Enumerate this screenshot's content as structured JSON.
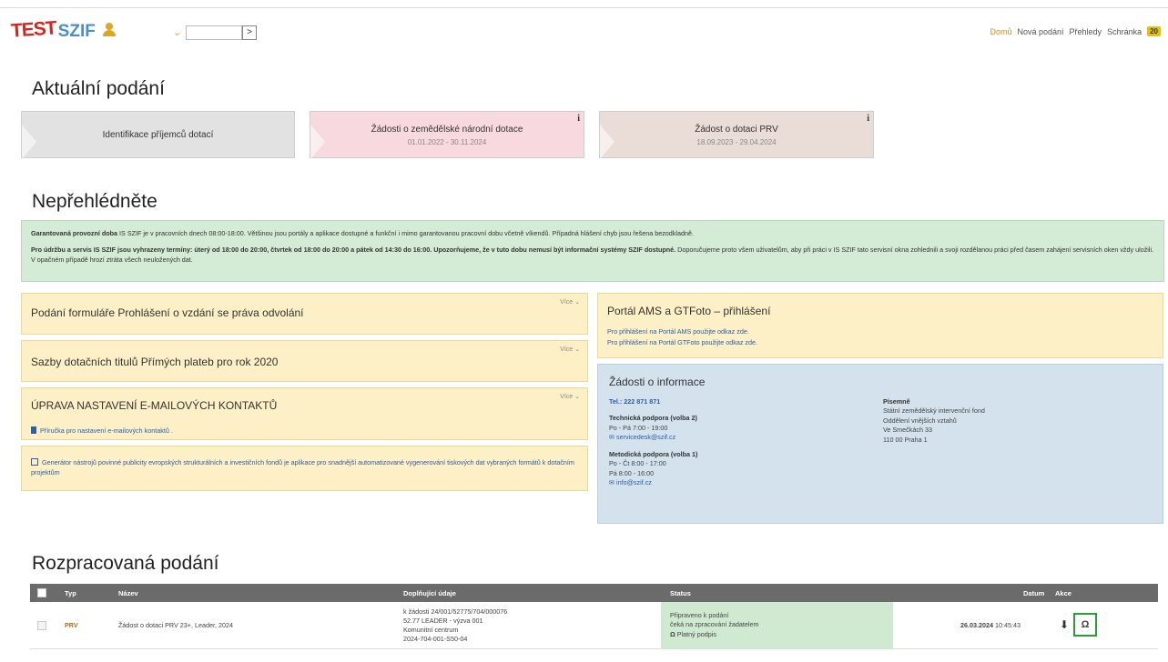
{
  "header": {
    "logo_test": "TEST",
    "logo_szif": "SZIF",
    "go_symbol": ">",
    "nav": [
      "Domů",
      "Nová podání",
      "Přehledy",
      "Schránka"
    ],
    "inbox_count": "20"
  },
  "current": {
    "title": "Aktuální podání",
    "tiles": [
      {
        "title": "Identifikace příjemců dotací",
        "dates": ""
      },
      {
        "title": "Žádosti o zemědělské národní dotace",
        "dates": "01.01.2022 - 30.11.2024",
        "info": "i"
      },
      {
        "title": "Žádost o dotaci PRV",
        "dates": "18.09.2023 - 29.04.2024",
        "info": "i"
      }
    ]
  },
  "notice": {
    "title": "Nepřehlédněte",
    "p1_bold": "Garantovaná provozní doba",
    "p1_rest": " IS SZIF je v pracovních dnech 08:00-18:00. Většinou jsou portály a aplikace dostupné a funkční i mimo garantovanou pracovní dobu včetně víkendů. Případná hlášení chyb jsou řešena bezodkladně.",
    "p2_bold": "Pro údržbu a servis IS SZIF jsou vyhrazeny termíny: úterý od 18:00 do 20:00, čtvrtek od 18:00 do 20:00 a pátek od 14:30 do 16:00. Upozorňujeme, že v tuto dobu nemusí být informační systémy SZIF dostupné.",
    "p2_rest": " Doporučujeme proto všem uživatelům, aby při práci v IS SZIF tato servisní okna zohlednili a svoji rozdělanou práci před časem zahájení servisních oken vždy uložili. V opačném případě hrozí ztráta všech neuložených dat."
  },
  "cards": {
    "more": "Více",
    "card1": "Podání formuláře Prohlášení o vzdání se práva odvolání",
    "card2": "Sazby dotačních titulů Přímých plateb pro rok 2020",
    "card3": "ÚPRAVA NASTAVENÍ E-MAILOVÝCH KONTAKTŮ",
    "card3_link": "Příručka pro nastavení e-mailových kontaktů .",
    "card4": "Generátor nástrojů povinné publicity evropských strukturálních a investičních fondů je aplikace pro snadnější automatizované vygenerování tiskových dat vybraných formátů k dotačním projektům",
    "portal_title": "Portál AMS a GTFoto – přihlášení",
    "portal_l1": "Pro přihlášení na Portál AMS použijte odkaz zde.",
    "portal_l2": "Pro přihlášení na Portál GTFoto použijte odkaz zde."
  },
  "info": {
    "title": "Žádosti o informace",
    "tel": "Tel.: 222 871 871",
    "tech_label": "Technická podpora (volba 2)",
    "tech_hours": "Po - Pá 7:00 - 19:00",
    "tech_mail": "servicedesk@szif.cz",
    "met_label": "Metodická podpora (volba 1)",
    "met_h1": "Po - Čt 8:00 - 17:00",
    "met_h2": "Pá 8:00 - 16:00",
    "met_mail": "info@szif.cz",
    "post_label": "Písemně",
    "post_l1": "Státní zemědělský intervenční fond",
    "post_l2": "Oddělení vnějších vztahů",
    "post_l3": "Ve Smečkách 33",
    "post_l4": "110 00 Praha 1"
  },
  "drafts": {
    "title": "Rozpracovaná podání",
    "columns": [
      "Typ",
      "Název",
      "Doplňující údaje",
      "Status",
      "Datum",
      "Akce"
    ],
    "row": {
      "type": "PRV",
      "name": "Žádost o dotaci PRV 23+, Leader, 2024",
      "extra1": "k žádosti 24/001/52775/704/000076",
      "extra2": "52.77 LEADER - výzva 001",
      "extra3": "Komunitní centrum",
      "extra4": "2024-704-001-S50-04",
      "status1": "Připraveno k podání",
      "status2": "čeká na zpracování žadatelem",
      "status3": "Platný podpis",
      "date_bold": "26.03.2024",
      "date_time": "10:45:43"
    }
  },
  "colors": {
    "accent": "#e08a1e",
    "green": "#d4ebd6",
    "yellow": "#fdf0c6",
    "blue": "#d3e2ec",
    "header_bg": "#6b6b6b"
  }
}
